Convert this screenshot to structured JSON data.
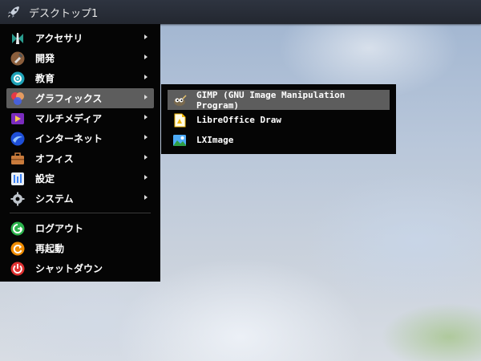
{
  "taskbar": {
    "title": "デスクトップ1",
    "icon": "rocket-icon"
  },
  "menu": {
    "items": [
      {
        "label": "アクセサリ",
        "icon": "accessories-icon"
      },
      {
        "label": "開発",
        "icon": "development-icon"
      },
      {
        "label": "教育",
        "icon": "education-icon"
      },
      {
        "label": "グラフィックス",
        "icon": "graphics-icon"
      },
      {
        "label": "マルチメディア",
        "icon": "multimedia-icon"
      },
      {
        "label": "インターネット",
        "icon": "internet-icon"
      },
      {
        "label": "オフィス",
        "icon": "office-icon"
      },
      {
        "label": "設定",
        "icon": "settings-icon"
      },
      {
        "label": "システム",
        "icon": "system-icon"
      }
    ],
    "actions": [
      {
        "label": "ログアウト",
        "icon": "logout-icon"
      },
      {
        "label": "再起動",
        "icon": "reboot-icon"
      },
      {
        "label": "シャットダウン",
        "icon": "shutdown-icon"
      }
    ]
  },
  "submenu": {
    "items": [
      {
        "label": "GIMP (GNU Image Manipulation Program)",
        "icon": "gimp-icon"
      },
      {
        "label": "LibreOffice Draw",
        "icon": "libreoffice-draw-icon"
      },
      {
        "label": "LXImage",
        "icon": "lximage-icon"
      }
    ]
  },
  "colors": {
    "highlight": "#5d5d5d",
    "menu_bg": "#050505"
  }
}
